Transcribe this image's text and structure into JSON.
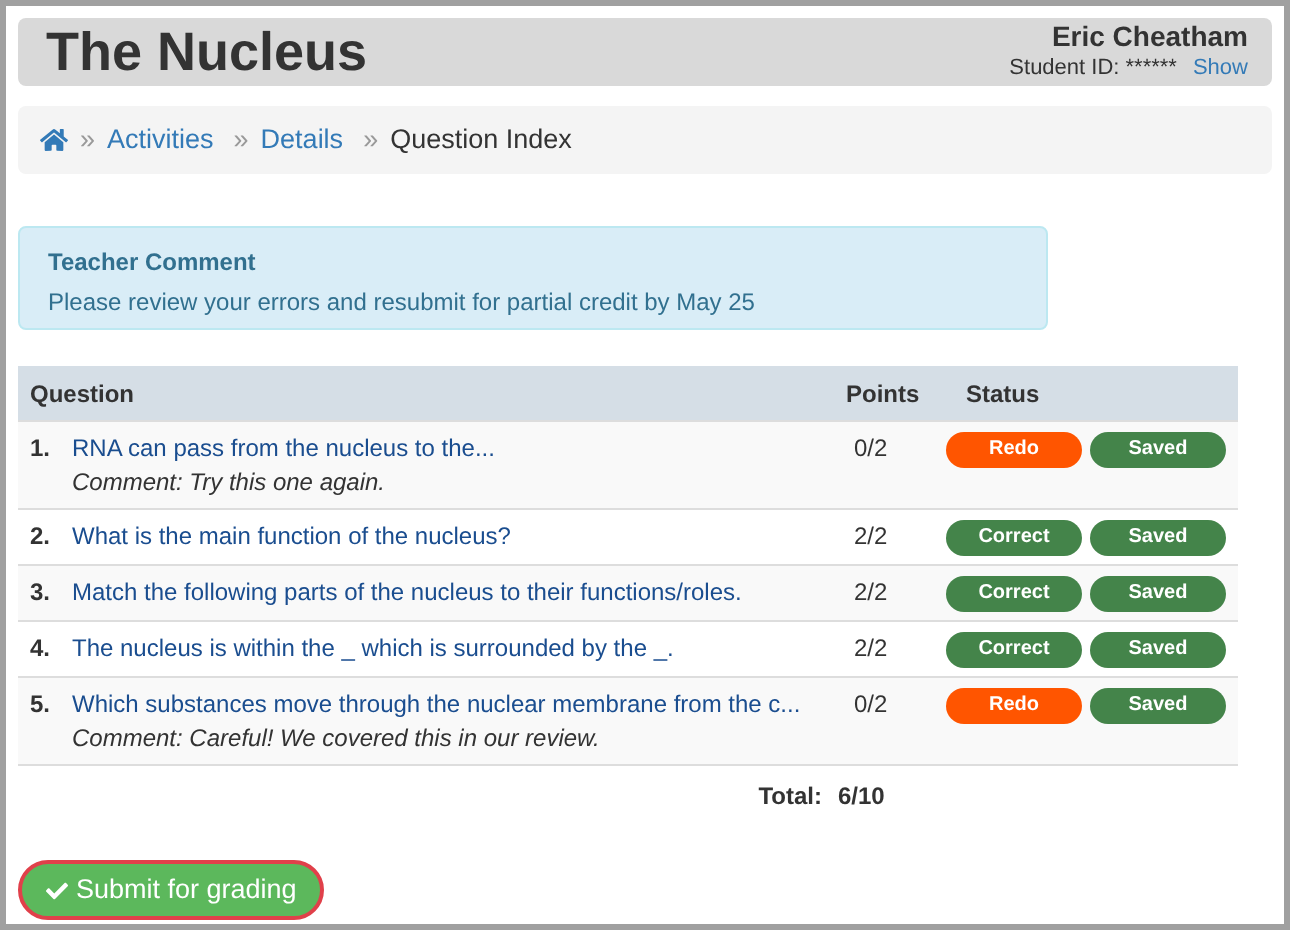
{
  "header": {
    "title": "The Nucleus",
    "student_name": "Eric Cheatham",
    "student_id_label": "Student ID:",
    "student_id_value": "******",
    "show_link": "Show"
  },
  "breadcrumb": [
    {
      "separator": "»",
      "label": "Activities",
      "kind": "link"
    },
    {
      "separator": "»",
      "label": "Details",
      "kind": "link"
    },
    {
      "separator": "»",
      "label": "Question Index",
      "kind": "current"
    }
  ],
  "teacher_comment": {
    "title": "Teacher Comment",
    "text": "Please review your errors and resubmit for partial credit by May 25"
  },
  "table": {
    "columns": [
      "Question",
      "Points",
      "Status"
    ],
    "rows": [
      {
        "number": "1.",
        "question": "RNA can pass from the nucleus to the...",
        "comment": "Comment: Try this one again.",
        "points": "0/2",
        "badges": [
          {
            "label": "Redo",
            "kind": "redo"
          },
          {
            "label": "Saved",
            "kind": "saved"
          }
        ]
      },
      {
        "number": "2.",
        "question": "What is the main function of the nucleus?",
        "points": "2/2",
        "badges": [
          {
            "label": "Correct",
            "kind": "correct"
          },
          {
            "label": "Saved",
            "kind": "saved"
          }
        ]
      },
      {
        "number": "3.",
        "question": "Match the following parts of the nucleus to their functions/roles.",
        "points": "2/2",
        "badges": [
          {
            "label": "Correct",
            "kind": "correct"
          },
          {
            "label": "Saved",
            "kind": "saved"
          }
        ]
      },
      {
        "number": "4.",
        "question": "The nucleus is within the _ which is surrounded by the _.",
        "points": "2/2",
        "badges": [
          {
            "label": "Correct",
            "kind": "correct"
          },
          {
            "label": "Saved",
            "kind": "saved"
          }
        ]
      },
      {
        "number": "5.",
        "question": "Which substances move through the nuclear membrane from the c...",
        "comment": "Comment: Careful! We covered this in our review.",
        "points": "0/2",
        "badges": [
          {
            "label": "Redo",
            "kind": "redo"
          },
          {
            "label": "Saved",
            "kind": "saved"
          }
        ]
      }
    ],
    "total_label": "Total:",
    "total_value": "6/10"
  },
  "submit_button": {
    "label": "Submit for grading"
  }
}
